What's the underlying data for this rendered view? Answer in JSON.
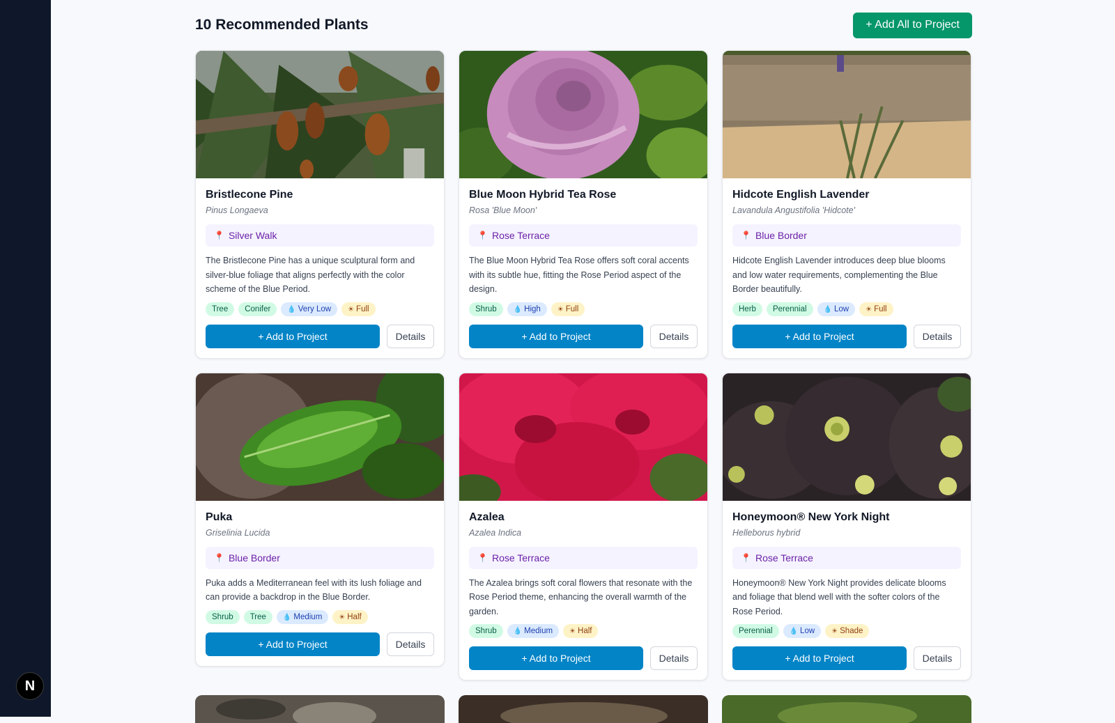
{
  "header": {
    "title": "10 Recommended Plants",
    "add_all_label": "+ Add All to Project"
  },
  "sidebar": {
    "badge_label": "N"
  },
  "card_actions": {
    "add_label": "+ Add to Project",
    "details_label": "Details"
  },
  "plants": [
    {
      "name": "Bristlecone Pine",
      "scientific": "Pinus Longaeva",
      "location": "Silver Walk",
      "description": "The Bristlecone Pine has a unique sculptural form and silver-blue foliage that aligns perfectly with the color scheme of the Blue Period.",
      "tags": [
        "Tree",
        "Conifer"
      ],
      "water": "Very Low",
      "sun": "Full"
    },
    {
      "name": "Blue Moon Hybrid Tea Rose",
      "scientific": "Rosa 'Blue Moon'",
      "location": "Rose Terrace",
      "description": "The Blue Moon Hybrid Tea Rose offers soft coral accents with its subtle hue, fitting the Rose Period aspect of the design.",
      "tags": [
        "Shrub"
      ],
      "water": "High",
      "sun": "Full"
    },
    {
      "name": "Hidcote English Lavender",
      "scientific": "Lavandula Angustifolia 'Hidcote'",
      "location": "Blue Border",
      "description": "Hidcote English Lavender introduces deep blue blooms and low water requirements, complementing the Blue Border beautifully.",
      "tags": [
        "Herb",
        "Perennial"
      ],
      "water": "Low",
      "sun": "Full"
    },
    {
      "name": "Puka",
      "scientific": "Griselinia Lucida",
      "location": "Blue Border",
      "description": "Puka adds a Mediterranean feel with its lush foliage and can provide a backdrop in the Blue Border.",
      "tags": [
        "Shrub",
        "Tree"
      ],
      "water": "Medium",
      "sun": "Half"
    },
    {
      "name": "Azalea",
      "scientific": "Azalea Indica",
      "location": "Rose Terrace",
      "description": "The Azalea brings soft coral flowers that resonate with the Rose Period theme, enhancing the overall warmth of the garden.",
      "tags": [
        "Shrub"
      ],
      "water": "Medium",
      "sun": "Half"
    },
    {
      "name": "Honeymoon® New York Night",
      "scientific": "Helleborus hybrid",
      "location": "Rose Terrace",
      "description": "Honeymoon® New York Night provides delicate blooms and foliage that blend well with the softer colors of the Rose Period.",
      "tags": [
        "Perennial"
      ],
      "water": "Low",
      "sun": "Shade"
    }
  ],
  "colors": {
    "sidebar": "#0f172a",
    "add_all": "#059669",
    "add_button": "#0284c7",
    "location_text": "#6b21a8"
  }
}
